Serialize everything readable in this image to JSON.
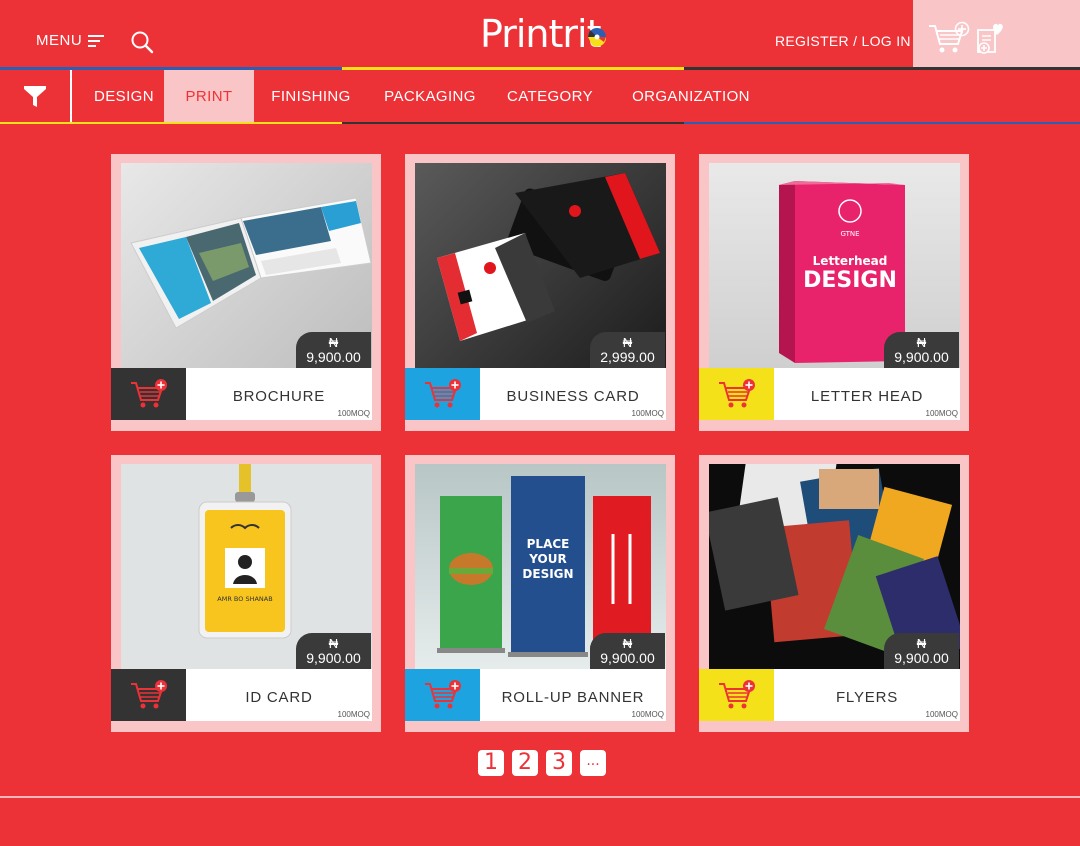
{
  "header": {
    "menu_label": "MENU",
    "logo_text": "Printrit",
    "register_label": "REGISTER / LOG IN"
  },
  "nav": {
    "tabs": [
      {
        "label": "DESIGN"
      },
      {
        "label": "PRINT"
      },
      {
        "label": "FINISHING"
      },
      {
        "label": "PACKAGING"
      },
      {
        "label": "CATEGORY"
      },
      {
        "label": "ORGANIZATION"
      }
    ]
  },
  "products": [
    {
      "name": "BROCHURE",
      "currency": "₦",
      "price": "9,900.00",
      "moq": "100MOQ",
      "cart_color": "#333333"
    },
    {
      "name": "BUSINESS CARD",
      "currency": "₦",
      "price": "2,999.00",
      "moq": "100MOQ",
      "cart_color": "#1da3e0"
    },
    {
      "name": "LETTER HEAD",
      "currency": "₦",
      "price": "9,900.00",
      "moq": "100MOQ",
      "cart_color": "#f5e11a"
    },
    {
      "name": "ID CARD",
      "currency": "₦",
      "price": "9,900.00",
      "moq": "100MOQ",
      "cart_color": "#333333"
    },
    {
      "name": "ROLL-UP BANNER",
      "currency": "₦",
      "price": "9,900.00",
      "moq": "100MOQ",
      "cart_color": "#1da3e0"
    },
    {
      "name": "FLYERS",
      "currency": "₦",
      "price": "9,900.00",
      "moq": "100MOQ",
      "cart_color": "#f5e11a"
    }
  ],
  "images": {
    "brochure_title": "Letterhead",
    "letterhead_text1": "Letterhead",
    "letterhead_text2": "DESIGN",
    "letterhead_brand": "GTNE",
    "idcard_name": "AMR BO SHANAB",
    "banner_text1": "PLACE",
    "banner_text2": "YOUR",
    "banner_text3": "DESIGN"
  },
  "pagination": {
    "pages": [
      "1",
      "2",
      "3"
    ],
    "more": "..."
  },
  "colors": {
    "brand_red": "#ed3237",
    "light_pink": "#f9c5c7",
    "blue": "#1da3e0",
    "yellow": "#f5e11a",
    "dark": "#333333"
  }
}
